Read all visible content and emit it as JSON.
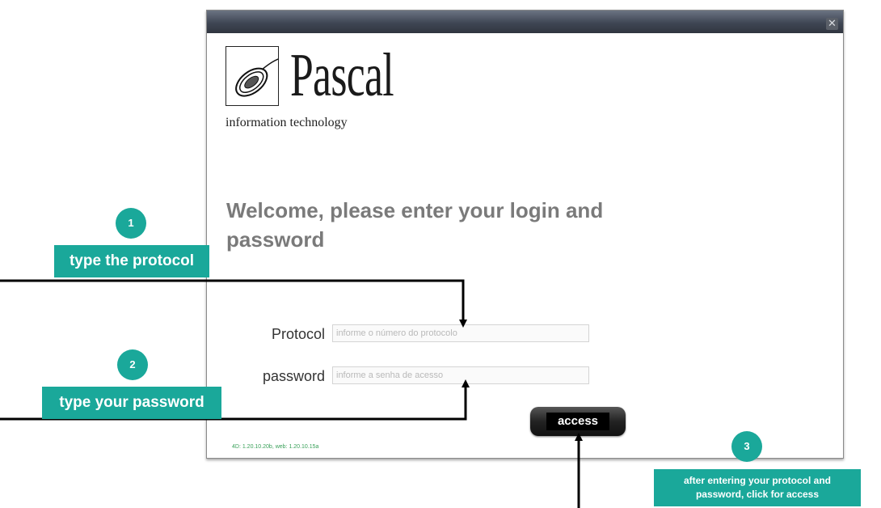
{
  "window": {
    "close_glyph": "✕",
    "logo": {
      "icon": "mouse-icon",
      "wordmark": "Pascal",
      "tagline": "information technology"
    },
    "welcome": "Welcome, please enter your login and password",
    "protocol": {
      "label": "Protocol",
      "placeholder": "informe o número do protocolo",
      "value": ""
    },
    "password": {
      "label": "password",
      "placeholder": "informe a senha de acesso",
      "value": ""
    },
    "access_label": "access",
    "version": "4D: 1.20.10.20b, web: 1.20.10.15a"
  },
  "annotations": {
    "accent_color": "#1aa89a",
    "steps": [
      {
        "number": "1",
        "text": "type the protocol"
      },
      {
        "number": "2",
        "text": "type your password"
      },
      {
        "number": "3",
        "text": "after entering your protocol and password, click for access"
      }
    ]
  }
}
